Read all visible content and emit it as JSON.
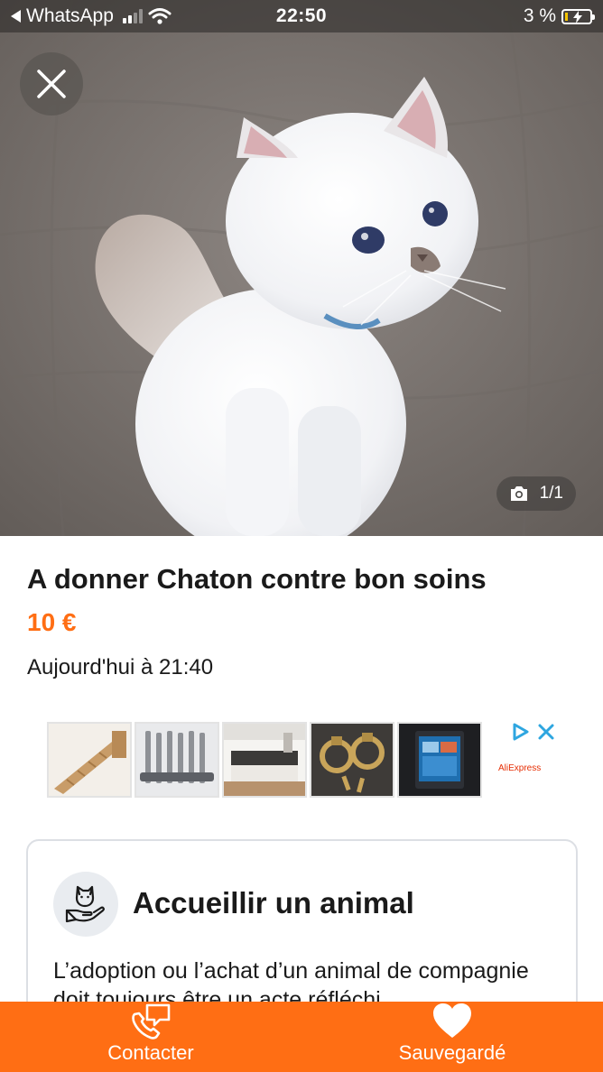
{
  "status_bar": {
    "back_app": "WhatsApp",
    "time": "22:50",
    "battery": "3 %"
  },
  "gallery": {
    "close_icon": "close-icon",
    "counter": "1/1",
    "camera_icon": "camera-icon"
  },
  "listing": {
    "title": "A donner Chaton contre bon soins",
    "price": "10 €",
    "date": "Aujourd'hui à 21:40"
  },
  "ad": {
    "brand": "AliExpress",
    "thumbnails": [
      "cat-ladder",
      "drill-bits",
      "kitchen",
      "door-knockers",
      "car-stereo"
    ]
  },
  "info_card": {
    "title": "Accueillir un animal",
    "text": "L’adoption ou l’achat d’un animal de compagnie doit toujours être un acte réfléchi"
  },
  "bottom_bar": {
    "contact_label": "Contacter",
    "save_label": "Sauvegardé"
  },
  "colors": {
    "accent": "#ff6e14",
    "text": "#1a1a1a",
    "card_border": "#dcdfe4"
  }
}
